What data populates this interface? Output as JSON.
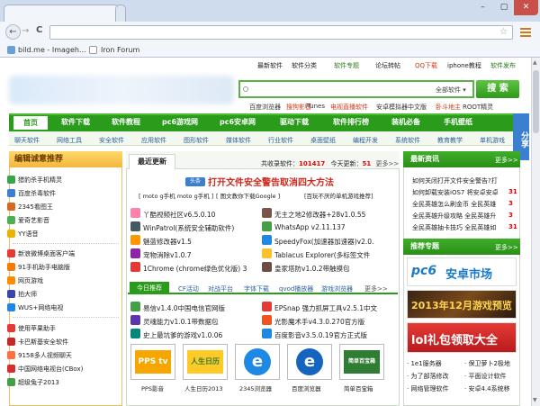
{
  "browser": {
    "tabs": [
      {
        "label": "bild.me - Imageh..."
      },
      {
        "label": "Iron Forum"
      }
    ],
    "bookmarks": [
      {
        "label": "bild.me - Imageh..."
      },
      {
        "label": "Iron Forum"
      }
    ],
    "window_controls": {
      "minimize": "–",
      "maximize": "▢",
      "close": "✕"
    },
    "nav": {
      "back": "←",
      "forward": "→",
      "reload": "C"
    }
  },
  "site": {
    "top_links": [
      "最新软件",
      "软件分类",
      "软件专题",
      "论坛转帖",
      "QQ下载",
      "iphone教程",
      "软件发布"
    ],
    "search": {
      "dropdown": "全部软件",
      "button": "搜 索",
      "hot": [
        "百度浏览器",
        "搜狗影音",
        "iTunes",
        "电视直播软件",
        "安卓模拟器中文版",
        "卧斗地主",
        "ROOT精灵"
      ]
    },
    "main_nav": [
      "首页",
      "软件下载",
      "软件教程",
      "pc6游戏网",
      "pc6安卓网",
      "驱动下载",
      "软件排行榜",
      "装机必备",
      "手机壁纸"
    ],
    "sub_nav": [
      "聊天软件",
      "网络工具",
      "安全软件",
      "应用软件",
      "图形软件",
      "媒体软件",
      "行业软件",
      "桌面壁纸",
      "编程开发",
      "系统软件",
      "教育教学",
      "单机游戏"
    ],
    "share": "分享",
    "left": {
      "title": "编辑诚意推荐",
      "group1": [
        "猎豹杀手机精灵",
        "百度杀毒软件",
        "2345看图王",
        "爱奇艺影音",
        "YY语音"
      ],
      "group2": [
        "新浪微博桌面客户端",
        "91手机助手电脑版",
        "网页游戏",
        "拍大师",
        "WUS+网络电视"
      ],
      "group3": [
        "使用苹果助手",
        "卡巴斯基安全软件",
        "9158多人视频聊天",
        "中国网络电视台(CBox)",
        "超级兔子2013"
      ]
    },
    "center": {
      "tab": "最近更新",
      "stats_label": "共收录软件：",
      "stats_total": "101417",
      "today_label": "今天更新：",
      "today_count": "51",
      "more": "更多>>",
      "alert_tag": "头条",
      "alert": "打开文件安全警告取消四大方法",
      "sub_links": [
        "[ moto g手机 moto g手机 ]",
        "[ 图文教你下载Google ]",
        "[百玩不厌的单机游戏推荐]"
      ],
      "list1": [
        [
          "丫酷视频社区v6.5.0.10",
          "无主之地2修改器+28v1.0.55"
        ],
        [
          "WinPatrol(系统安全辅助软件)",
          "WhatsApp v2.11.137"
        ],
        [
          "魅蓝修改器v1.5",
          "SpeedyFox(加速器加速器)v2.0."
        ],
        [
          "宠物消除v1.0.7",
          "Tablacus Explorer(多标签文件"
        ],
        [
          "1Chrome (chrome绿色优化版) 3",
          "皇家塔防v1.0.2带触摸包"
        ]
      ],
      "subtabs": [
        "今日推荐",
        "CF活动",
        "对战平台",
        "字体下载",
        "qvod播放器",
        "游戏浏览器",
        "更多>>"
      ],
      "list2": [
        [
          "易信v1.4.0中国电信官网版",
          "EPSnap 强力抓屏工具v2.5.1中文"
        ],
        [
          "灵魂能力v1.0.1带数据包",
          "光影魔术手v4.3.0.270官方版"
        ],
        [
          "史上最坑爹的游戏v1.0.06",
          "百度影音v3.5.0.19官方正式版"
        ]
      ],
      "thumbs": [
        "PPS影音",
        "人生日历2013",
        "2345浏览器",
        "百度浏览器",
        "简单百宝箱"
      ],
      "thumb_logos": [
        "PPS tv",
        "人生日历",
        " e ",
        " e ",
        "简单百宝箱"
      ]
    },
    "right": {
      "news_title": "最新资讯",
      "news_more": "更多>>",
      "news": [
        [
          "如何关闭打开文件安全警告?打",
          ""
        ],
        [
          "如何卸载安装iOS7 将安卓安卓",
          "31"
        ],
        [
          "全民英雄怎么刷金币 全民英雄",
          "3"
        ],
        [
          "全民英雄升级攻略 全民英雄升",
          "3"
        ],
        [
          "全民英雄抽卡技巧 全民英雄如",
          "31"
        ]
      ],
      "promo_title": "推荐专题",
      "promo_more": "更多>>",
      "banner1": "安卓市场",
      "banner1_brand": "pc6",
      "banner2": "2013年12月游戏预览",
      "banner3": "lol礼包领取大全",
      "bottom": [
        [
          "1e1服务器",
          "保卫萝卜2极地"
        ],
        [
          "为了部落修改",
          "平面设计软件"
        ],
        [
          "网络管理软件",
          "安卓4.4系统移"
        ]
      ]
    }
  }
}
